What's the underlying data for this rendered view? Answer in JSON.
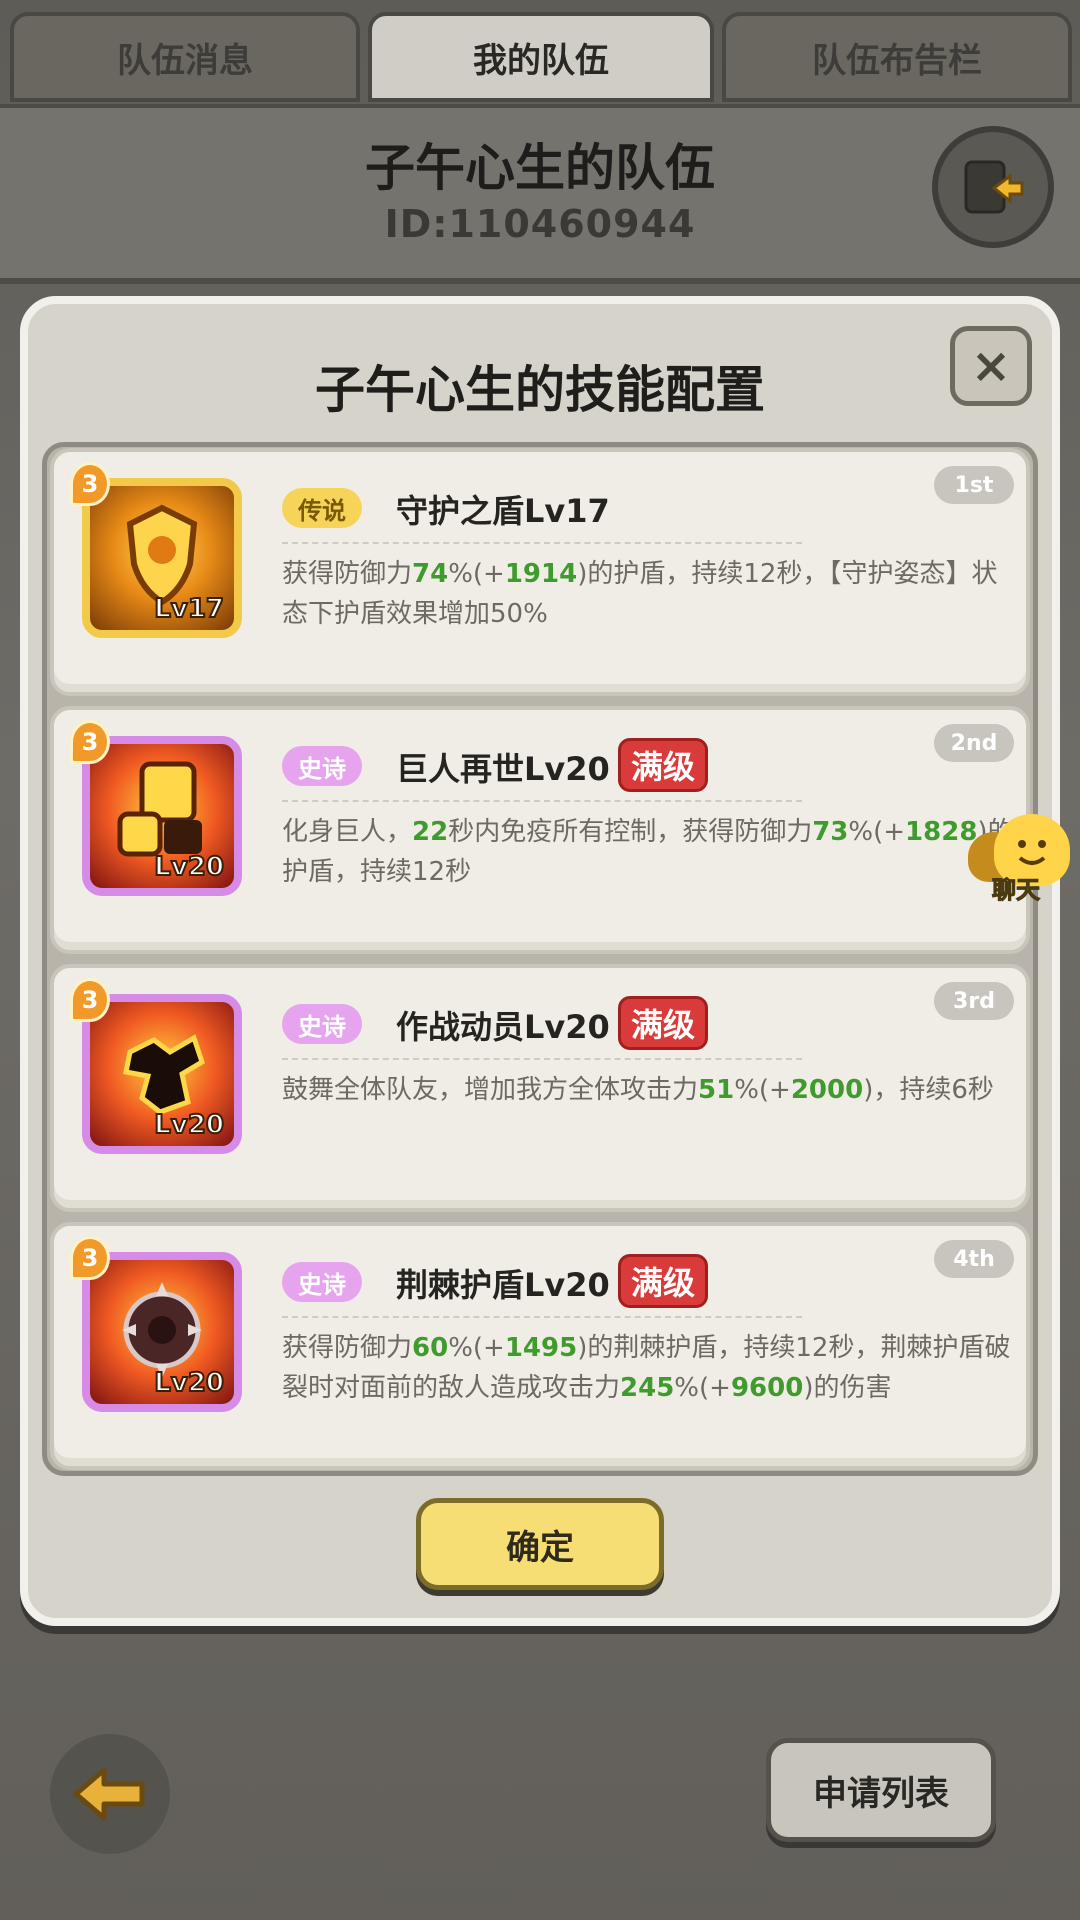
{
  "tabs": [
    {
      "label": "队伍消息"
    },
    {
      "label": "我的队伍"
    },
    {
      "label": "队伍布告栏"
    }
  ],
  "team": {
    "name": "子午心生的队伍",
    "id": "ID:110460944"
  },
  "modal": {
    "title": "子午心生的技能配置",
    "close_label": "×"
  },
  "skills": [
    {
      "badge": "3",
      "level_label": "Lv17",
      "rarity": "传说",
      "name": "守护之盾Lv17",
      "maxed": "",
      "order": "1st",
      "desc_parts": [
        "获得防御力",
        "74",
        "%(+",
        "1914",
        ")的护盾，持续12秒，【守护姿态】状态下护盾效果增加50%"
      ]
    },
    {
      "badge": "3",
      "level_label": "Lv20",
      "rarity": "史诗",
      "name": "巨人再世Lv20",
      "maxed": "满级",
      "order": "2nd",
      "desc_parts": [
        "化身巨人，",
        "22",
        "秒内免疫所有控制，获得防御力",
        "73",
        "%(+",
        "1828",
        ")的护盾，持续12秒"
      ]
    },
    {
      "badge": "3",
      "level_label": "Lv20",
      "rarity": "史诗",
      "name": "作战动员Lv20",
      "maxed": "满级",
      "order": "3rd",
      "desc_parts": [
        "鼓舞全体队友，增加我方全体攻击力",
        "51",
        "%(+",
        "2000",
        ")，持续6秒"
      ]
    },
    {
      "badge": "3",
      "level_label": "Lv20",
      "rarity": "史诗",
      "name": "荆棘护盾Lv20",
      "maxed": "满级",
      "order": "4th",
      "desc_parts": [
        "获得防御力",
        "60",
        "%(+",
        "1495",
        ")的荆棘护盾，持续12秒，荆棘护盾破裂时对面前的敌人造成攻击力",
        "245",
        "%(+",
        "9600",
        ")的伤害"
      ]
    }
  ],
  "confirm_label": "确定",
  "chat_label": "聊天",
  "apply_list_label": "申请列表",
  "colors": {
    "highlight_green": "#3f9b2d",
    "legend_tag": "#f6d45a",
    "epic_tag": "#e6a4ee",
    "maxed_red": "#d93a3a",
    "confirm_yellow": "#f6de74"
  }
}
